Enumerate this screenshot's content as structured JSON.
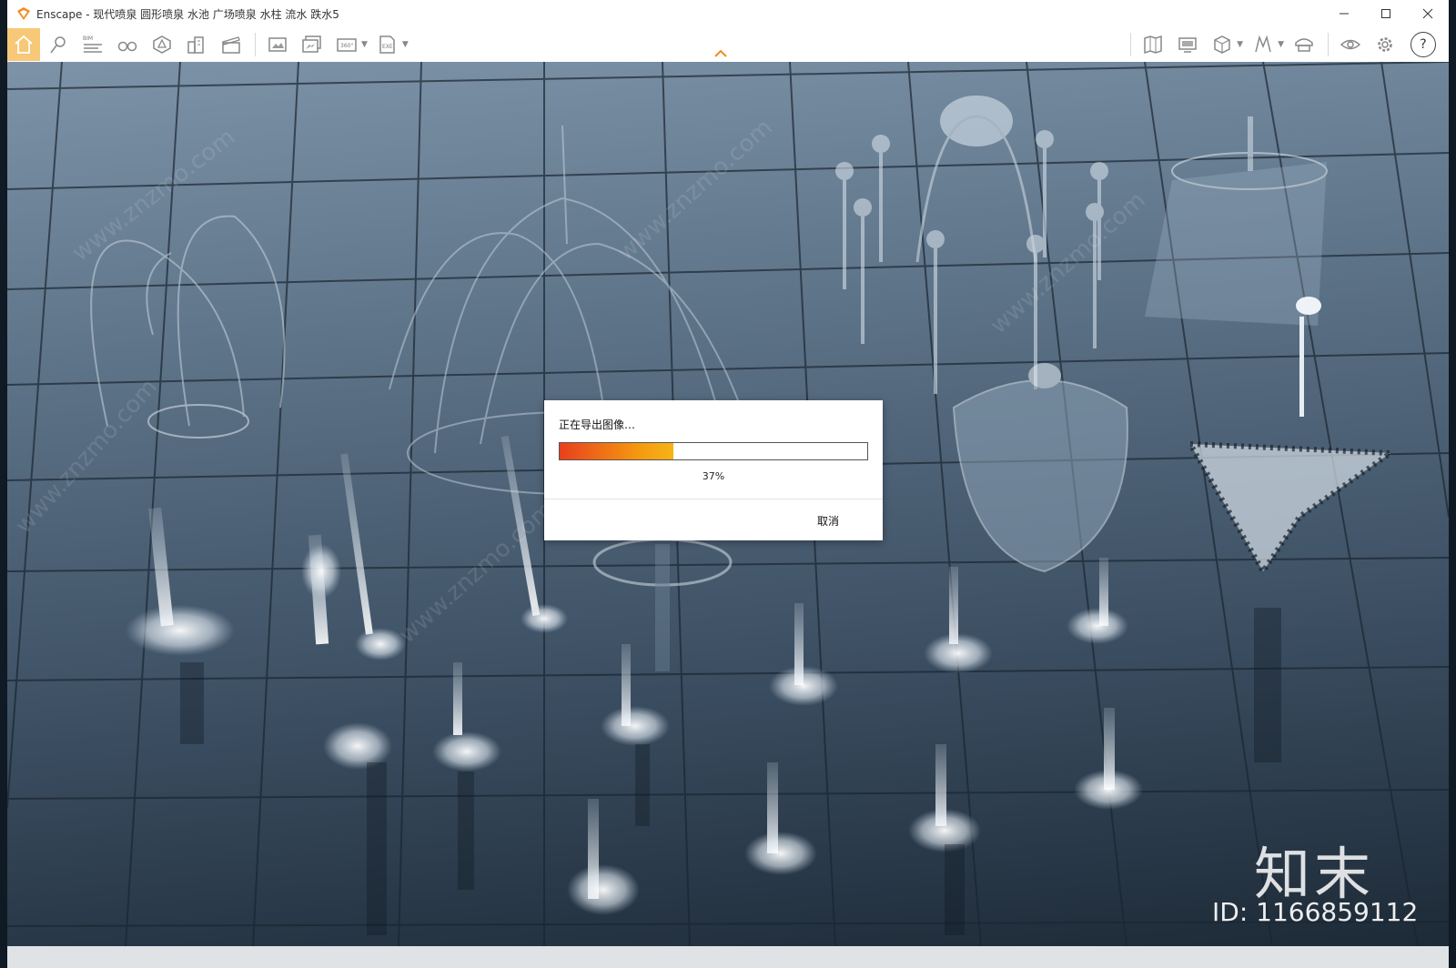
{
  "window": {
    "title": "Enscape - 现代喷泉 圆形喷泉 水池 广场喷泉 水柱 流水 跌水5",
    "controls": [
      "minimize",
      "maximize",
      "close"
    ]
  },
  "toolbar": {
    "left_icons": [
      "home-icon",
      "pin-icon",
      "bim-icon",
      "binoculars-icon",
      "asset-library-icon",
      "buildings-icon",
      "clapper-icon",
      "screenshot-icon",
      "batch-render-icon",
      "panorama-icon",
      "export-icon"
    ],
    "bim_label": "BIM",
    "panorama_label": "360°",
    "export_label": "EXE",
    "right_icons": [
      "map-icon",
      "monitor-icon",
      "cube-icon",
      "vr-icon",
      "cap-icon",
      "eye-icon",
      "gear-icon",
      "help-icon"
    ],
    "help_label": "?",
    "accent_color": "#f7c877"
  },
  "dialog": {
    "title": "正在导出图像…",
    "progress": 0.37,
    "progress_text": "37%",
    "cancel_label": "取消"
  },
  "watermark": {
    "brand": "知末",
    "id": "ID: 1166859112",
    "text": "www.znzmo.com"
  }
}
